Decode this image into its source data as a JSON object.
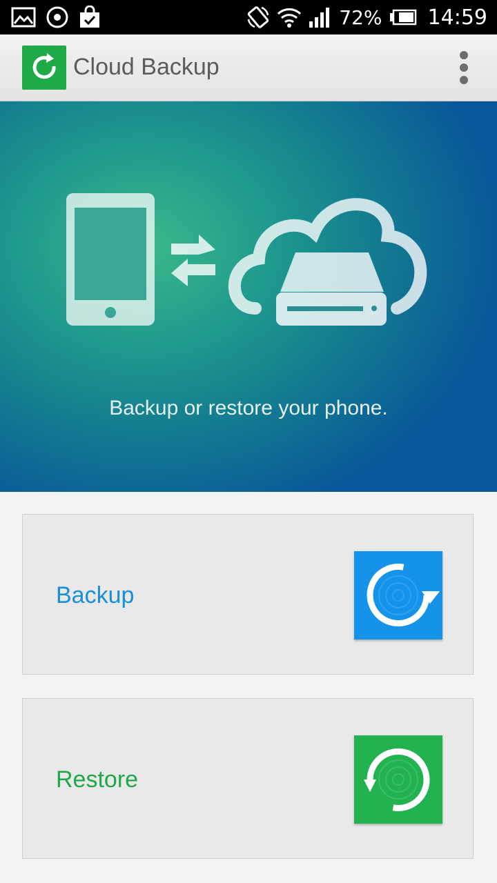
{
  "status_bar": {
    "icons": [
      "gallery-icon",
      "media-icon",
      "shopping-bag-icon",
      "rotation-lock-icon",
      "wifi-icon",
      "signal-icon",
      "battery-icon"
    ],
    "battery": "72%",
    "time": "14:59"
  },
  "action_bar": {
    "app_icon": "sync-icon",
    "title": "Cloud Backup",
    "menu_icon": "overflow-menu-icon"
  },
  "hero": {
    "illustration": [
      "phone-icon",
      "transfer-arrows-icon",
      "cloud-drive-icon"
    ],
    "caption": "Backup or restore your phone."
  },
  "options": [
    {
      "label": "Backup",
      "label_color": "#1a8fd8",
      "tile_color": "#1593ea",
      "icon": "backup-icon"
    },
    {
      "label": "Restore",
      "label_color": "#1fa84a",
      "tile_color": "#22b350",
      "icon": "restore-icon"
    }
  ]
}
